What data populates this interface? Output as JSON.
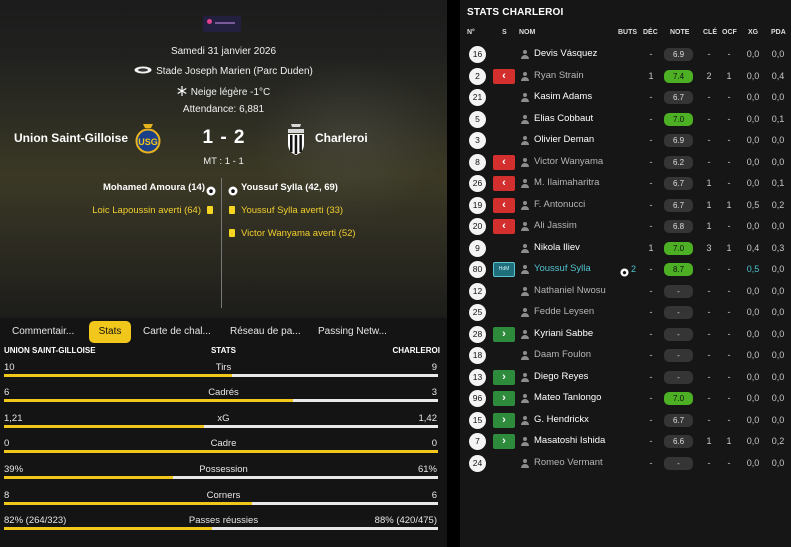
{
  "match": {
    "date": "Samedi 31 janvier 2026",
    "stadium": "Stade Joseph Marien (Parc Duden)",
    "weather": "Neige légère -1°C",
    "attendance_label": "Attendance:",
    "attendance_value": "6,881",
    "home_team": "Union Saint-Gilloise",
    "away_team": "Charleroi",
    "score": "1 - 2",
    "halftime": "MT : 1 - 1",
    "home_scorer": "Mohamed Amoura (14)",
    "away_scorer": "Youssuf Sylla (42, 69)",
    "home_cards": [
      "Loic Lapoussin averti (64)"
    ],
    "away_cards": [
      "Youssuf Sylla averti (33)",
      "Victor Wanyama averti (52)"
    ]
  },
  "tabs": [
    {
      "label": "Commentair...",
      "active": false
    },
    {
      "label": "Stats",
      "active": true
    },
    {
      "label": "Carte de chal...",
      "active": false
    },
    {
      "label": "Réseau de pa...",
      "active": false
    },
    {
      "label": "Passing Netw...",
      "active": false
    }
  ],
  "stats_header": {
    "home": "UNION SAINT-GILLOISE",
    "center": "STATS",
    "away": "CHARLEROI"
  },
  "stats": [
    {
      "label": "Tirs",
      "home": "10",
      "away": "9",
      "home_share": 0.526
    },
    {
      "label": "Cadrés",
      "home": "6",
      "away": "3",
      "home_share": 0.667
    },
    {
      "label": "xG",
      "home": "1,21",
      "away": "1,42",
      "home_share": 0.46
    },
    {
      "label": "Cadre",
      "home": "0",
      "away": "0",
      "home_share": 1.0
    },
    {
      "label": "Possession",
      "home": "39%",
      "away": "61%",
      "home_share": 0.39
    },
    {
      "label": "Corners",
      "home": "8",
      "away": "6",
      "home_share": 0.571
    },
    {
      "label": "Passes réussies",
      "home": "82% (264/323)",
      "away": "88% (420/475)",
      "home_share": 0.48
    }
  ],
  "right_panel": {
    "title": "STATS CHARLEROI",
    "headers": {
      "num": "N°",
      "s": "S",
      "nom": "NOM",
      "buts": "BUTS",
      "dec": "DÉC",
      "note": "NOTE",
      "cle": "CLÉ",
      "ocf": "OCF",
      "xg": "XG",
      "pda": "PDA"
    },
    "motm_label": "HdM",
    "players": [
      {
        "num": "16",
        "sub": "",
        "name": "Devis Vásquez",
        "style": "white",
        "buts": "",
        "dec": "-",
        "note": "6.9",
        "note_color": "grey",
        "cle": "-",
        "ocf": "-",
        "xg": "0,0",
        "pda": "0,0"
      },
      {
        "num": "2",
        "sub": "out",
        "name": "Ryan Strain",
        "style": "dim",
        "buts": "",
        "dec": "1",
        "note": "7.4",
        "note_color": "green",
        "cle": "2",
        "ocf": "1",
        "xg": "0,0",
        "pda": "0,4"
      },
      {
        "num": "21",
        "sub": "",
        "name": "Kasim Adams",
        "style": "white",
        "buts": "",
        "dec": "-",
        "note": "6.7",
        "note_color": "grey",
        "cle": "-",
        "ocf": "-",
        "xg": "0,0",
        "pda": "0,0"
      },
      {
        "num": "5",
        "sub": "",
        "name": "Elias Cobbaut",
        "style": "white",
        "buts": "",
        "dec": "-",
        "note": "7.0",
        "note_color": "green",
        "cle": "-",
        "ocf": "-",
        "xg": "0,0",
        "pda": "0,1"
      },
      {
        "num": "3",
        "sub": "",
        "name": "Olivier Deman",
        "style": "white",
        "buts": "",
        "dec": "-",
        "note": "6.9",
        "note_color": "grey",
        "cle": "-",
        "ocf": "-",
        "xg": "0,0",
        "pda": "0,0"
      },
      {
        "num": "8",
        "sub": "out",
        "name": "Victor Wanyama",
        "style": "dim",
        "buts": "",
        "dec": "-",
        "note": "6.2",
        "note_color": "grey",
        "cle": "-",
        "ocf": "-",
        "xg": "0,0",
        "pda": "0,0"
      },
      {
        "num": "26",
        "sub": "out",
        "name": "M. Ilaimaharitra",
        "style": "dim",
        "buts": "",
        "dec": "-",
        "note": "6.7",
        "note_color": "grey",
        "cle": "1",
        "ocf": "-",
        "xg": "0,0",
        "pda": "0,1"
      },
      {
        "num": "19",
        "sub": "out",
        "name": "F. Antonucci",
        "style": "dim",
        "buts": "",
        "dec": "-",
        "note": "6.7",
        "note_color": "grey",
        "cle": "1",
        "ocf": "1",
        "xg": "0,5",
        "pda": "0,2"
      },
      {
        "num": "20",
        "sub": "out",
        "name": "Ali Jassim",
        "style": "dim",
        "buts": "",
        "dec": "-",
        "note": "6.8",
        "note_color": "grey",
        "cle": "1",
        "ocf": "-",
        "xg": "0,0",
        "pda": "0,0"
      },
      {
        "num": "9",
        "sub": "",
        "name": "Nikola Iliev",
        "style": "white",
        "buts": "",
        "dec": "1",
        "note": "7.0",
        "note_color": "green",
        "cle": "3",
        "ocf": "1",
        "xg": "0,4",
        "pda": "0,3"
      },
      {
        "num": "80",
        "sub": "motm",
        "name": "Youssuf Sylla",
        "style": "cyan",
        "buts": "2",
        "dec": "-",
        "note": "8.7",
        "note_color": "green",
        "cle": "-",
        "ocf": "-",
        "xg": "0,5",
        "pda": "0,0"
      },
      {
        "num": "12",
        "sub": "",
        "name": "Nathaniel Nwosu",
        "style": "dim",
        "buts": "",
        "dec": "-",
        "note": "-",
        "note_color": "grey",
        "cle": "-",
        "ocf": "-",
        "xg": "0,0",
        "pda": "0,0"
      },
      {
        "num": "25",
        "sub": "",
        "name": "Fedde Leysen",
        "style": "dim",
        "buts": "",
        "dec": "-",
        "note": "-",
        "note_color": "grey",
        "cle": "-",
        "ocf": "-",
        "xg": "0,0",
        "pda": "0,0"
      },
      {
        "num": "28",
        "sub": "in",
        "name": "Kyriani Sabbe",
        "style": "white",
        "buts": "",
        "dec": "-",
        "note": "-",
        "note_color": "grey",
        "cle": "-",
        "ocf": "-",
        "xg": "0,0",
        "pda": "0,0"
      },
      {
        "num": "18",
        "sub": "",
        "name": "Daam Foulon",
        "style": "dim",
        "buts": "",
        "dec": "-",
        "note": "-",
        "note_color": "grey",
        "cle": "-",
        "ocf": "-",
        "xg": "0,0",
        "pda": "0,0"
      },
      {
        "num": "13",
        "sub": "in",
        "name": "Diego Reyes",
        "style": "white",
        "buts": "",
        "dec": "-",
        "note": "-",
        "note_color": "grey",
        "cle": "-",
        "ocf": "-",
        "xg": "0,0",
        "pda": "0,0"
      },
      {
        "num": "96",
        "sub": "in",
        "name": "Mateo Tanlongo",
        "style": "white",
        "buts": "",
        "dec": "-",
        "note": "7.0",
        "note_color": "green",
        "cle": "-",
        "ocf": "-",
        "xg": "0,0",
        "pda": "0,0"
      },
      {
        "num": "15",
        "sub": "in",
        "name": "G. Hendrickx",
        "style": "white",
        "buts": "",
        "dec": "-",
        "note": "6.7",
        "note_color": "grey",
        "cle": "-",
        "ocf": "-",
        "xg": "0,0",
        "pda": "0,0"
      },
      {
        "num": "7",
        "sub": "in",
        "name": "Masatoshi Ishida",
        "style": "white",
        "buts": "",
        "dec": "-",
        "note": "6.6",
        "note_color": "grey",
        "cle": "1",
        "ocf": "1",
        "xg": "0,0",
        "pda": "0,2"
      },
      {
        "num": "24",
        "sub": "",
        "name": "Romeo Vermant",
        "style": "dim",
        "buts": "",
        "dec": "-",
        "note": "-",
        "note_color": "grey",
        "cle": "-",
        "ocf": "-",
        "xg": "0,0",
        "pda": "0,0"
      }
    ]
  },
  "colors": {
    "accent": "#f2c71b",
    "sub_out": "#d32f2f",
    "sub_in": "#2e8b3c",
    "note_green": "#4db024",
    "motm": "#4fc3d0"
  }
}
